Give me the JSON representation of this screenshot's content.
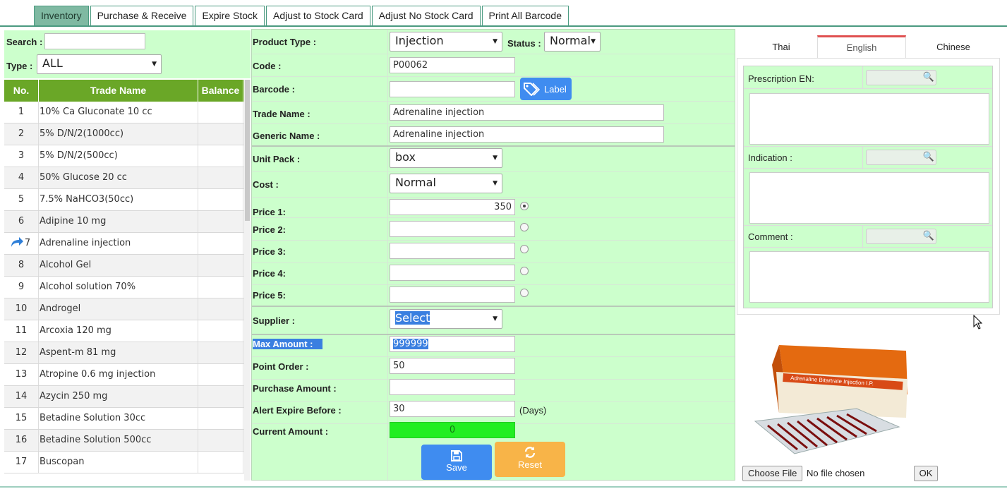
{
  "tabs": [
    "Inventory",
    "Purchase & Receive",
    "Expire Stock",
    "Adjust to Stock Card",
    "Adjust No Stock Card",
    "Print All Barcode"
  ],
  "left": {
    "search_label": "Search :",
    "search_value": "",
    "type_label": "Type :",
    "type_value": "ALL",
    "grid_headers": [
      "No.",
      "Trade Name",
      "Balance"
    ],
    "rows": [
      {
        "no": "1",
        "name": "10% Ca Gluconate 10 cc",
        "balance": ""
      },
      {
        "no": "2",
        "name": "5% D/N/2(1000cc)",
        "balance": ""
      },
      {
        "no": "3",
        "name": "5% D/N/2(500cc)",
        "balance": ""
      },
      {
        "no": "4",
        "name": "50% Glucose 20 cc",
        "balance": ""
      },
      {
        "no": "5",
        "name": "7.5% NaHCO3(50cc)",
        "balance": ""
      },
      {
        "no": "6",
        "name": "Adipine 10 mg",
        "balance": ""
      },
      {
        "no": "7",
        "name": "Adrenaline injection",
        "balance": ""
      },
      {
        "no": "8",
        "name": "Alcohol Gel",
        "balance": ""
      },
      {
        "no": "9",
        "name": "Alcohol solution 70%",
        "balance": ""
      },
      {
        "no": "10",
        "name": "Androgel",
        "balance": ""
      },
      {
        "no": "11",
        "name": "Arcoxia 120 mg",
        "balance": ""
      },
      {
        "no": "12",
        "name": "Aspent-m 81 mg",
        "balance": ""
      },
      {
        "no": "13",
        "name": "Atropine 0.6 mg injection",
        "balance": ""
      },
      {
        "no": "14",
        "name": "Azycin 250 mg",
        "balance": ""
      },
      {
        "no": "15",
        "name": "Betadine Solution 30cc",
        "balance": ""
      },
      {
        "no": "16",
        "name": "Betadine Solution 500cc",
        "balance": ""
      },
      {
        "no": "17",
        "name": "Buscopan",
        "balance": ""
      }
    ],
    "selected_row_icon": "arrow-pointer-icon"
  },
  "form": {
    "product_type_label": "Product Type :",
    "product_type_value": "Injection",
    "status_label": "Status :",
    "status_value": "Normal",
    "code_label": "Code :",
    "code_value": "P00062",
    "barcode_label": "Barcode :",
    "barcode_value": "",
    "label_button": "Label",
    "trade_name_label": "Trade Name :",
    "trade_name_value": "Adrenaline injection",
    "generic_name_label": "Generic Name :",
    "generic_name_value": "Adrenaline injection",
    "unit_pack_label": "Unit Pack :",
    "unit_pack_value": "box",
    "cost_label": "Cost :",
    "cost_value": "Normal",
    "prices": [
      {
        "label": "Price 1:",
        "value": "350",
        "selected": true
      },
      {
        "label": "Price 2:",
        "value": "",
        "selected": false
      },
      {
        "label": "Price 3:",
        "value": "",
        "selected": false
      },
      {
        "label": "Price 4:",
        "value": "",
        "selected": false
      },
      {
        "label": "Price 5:",
        "value": "",
        "selected": false
      }
    ],
    "supplier_label": "Supplier :",
    "supplier_value": "Select",
    "max_amount_label": "Max Amount :",
    "max_amount_value": "999999",
    "point_order_label": "Point Order :",
    "point_order_value": "50",
    "purchase_amount_label": "Purchase Amount :",
    "purchase_amount_value": "",
    "alert_expire_label": "Alert Expire Before :",
    "alert_expire_value": "30",
    "alert_expire_unit": "(Days)",
    "current_amount_label": "Current Amount :",
    "current_amount_value": "0",
    "save_label": "Save",
    "reset_label": "Reset"
  },
  "right": {
    "lang_tabs": [
      "Thai",
      "English",
      "Chinese"
    ],
    "active_lang": "English",
    "prescription_label": "Prescription EN:",
    "indication_label": "Indication :",
    "comment_label": "Comment :",
    "image_text": "Adrenaline Bitartrate Injection I.P.",
    "choose_file_label": "Choose File",
    "no_file_text": "No file chosen",
    "ok_label": "OK"
  },
  "colors": {
    "form_bg": "#ccffcc",
    "grid_header": "#6aa727",
    "save": "#3f8cf0",
    "reset": "#f8b448",
    "current_amount": "#22ee22",
    "active_tab": "#7fb9a2"
  }
}
